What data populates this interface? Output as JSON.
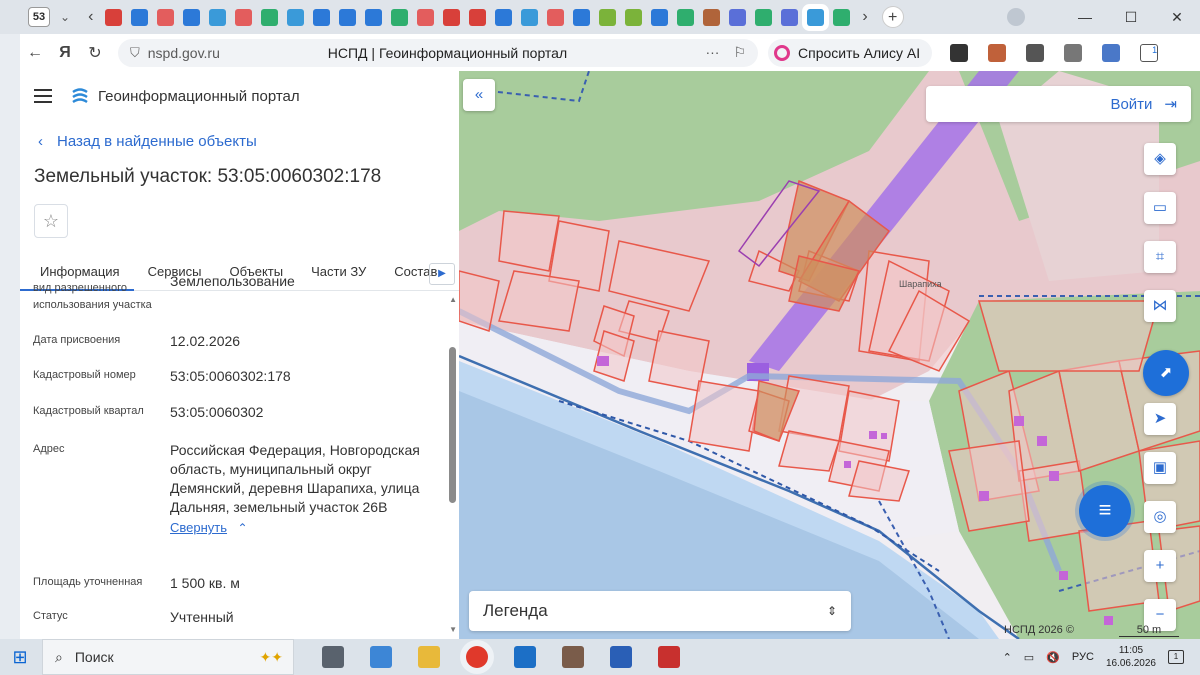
{
  "browser": {
    "tab_count": "53",
    "url": "nspd.gov.ru",
    "page_title": "НСПД | Геоинформационный портал",
    "alisa_label": "Спросить Алису AI",
    "downloads_badge": "1"
  },
  "sidebar": {
    "portal_name": "Геоинформационный портал",
    "back_link": "Назад в найденные объекты",
    "object_title": "Земельный участок: 53:05:0060302:178",
    "tabs": [
      "Информация",
      "Сервисы",
      "Объекты",
      "Части ЗУ",
      "Состав"
    ],
    "props": [
      {
        "label": "вид разрешенного использования участка",
        "value": "Землепользование"
      },
      {
        "label": "Дата присвоения",
        "value": "12.02.2026"
      },
      {
        "label": "Кадастровый номер",
        "value": "53:05:0060302:178"
      },
      {
        "label": "Кадастровый квартал",
        "value": "53:05:0060302"
      },
      {
        "label": "Адрес",
        "value": "Российская Федерация, Новгородская область, муниципальный округ Демянский, деревня Шарапиха, улица Дальняя, земельный участок 26В"
      },
      {
        "label": "Площадь уточненная",
        "value": "1 500 кв. м"
      },
      {
        "label": "Статус",
        "value": "Учтенный"
      }
    ],
    "collapse_label": "Свернуть"
  },
  "map": {
    "login_label": "Войти",
    "legend_label": "Легенда",
    "copyright": "НСПД 2026 ©",
    "scale_label": "50 m",
    "place_name": "Шарапиха"
  },
  "taskbar": {
    "search_label": "Поиск",
    "lang": "РУС",
    "time": "11:05",
    "date": "16.06.2026",
    "notifications": "1"
  },
  "colors": {
    "accent": "#2d6bcf",
    "parcel_stroke": "#e8584a",
    "highlight": "#9b5fe0"
  }
}
